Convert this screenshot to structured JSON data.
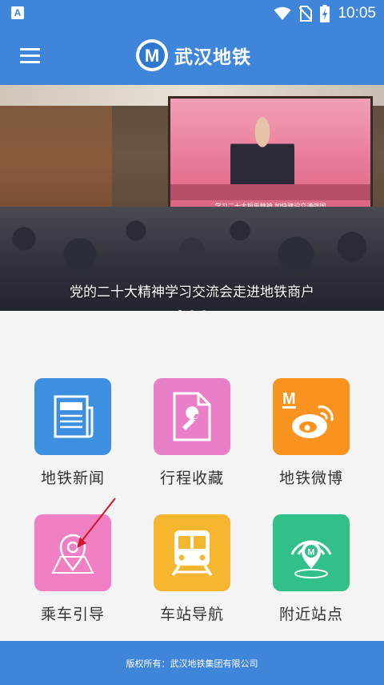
{
  "status_bar": {
    "time": "10:05",
    "left_icon_letter": "A",
    "icons": [
      "wifi-icon",
      "no-sim-icon",
      "battery-charging-icon"
    ]
  },
  "app_bar": {
    "title": "武汉地铁",
    "logo_letter": "M",
    "menu_icon": "menu-icon"
  },
  "banner": {
    "caption": "党的二十大精神学习交流会走进地铁商户",
    "screen_text": "学习二十大报告精神  加快建设交通强国",
    "slide_count": 3,
    "active_slide": 1
  },
  "tiles": [
    {
      "label": "地铁新闻",
      "icon": "newspaper-icon",
      "color": "#3d8fe0"
    },
    {
      "label": "行程收藏",
      "icon": "wrench-document-icon",
      "color": "#e97fc6"
    },
    {
      "label": "地铁微博",
      "icon": "weibo-icon",
      "color": "#f7931e"
    },
    {
      "label": "乘车引导",
      "icon": "map-pin-icon",
      "color": "#f07fc4"
    },
    {
      "label": "车站导航",
      "icon": "train-icon",
      "color": "#f6b52e"
    },
    {
      "label": "附近站点",
      "icon": "nearby-station-icon",
      "color": "#31c08a"
    }
  ],
  "footer": {
    "text": "版权所有：武汉地铁集团有限公司"
  },
  "colors": {
    "primary": "#3f86db",
    "annotation_arrow": "#d4152a"
  }
}
